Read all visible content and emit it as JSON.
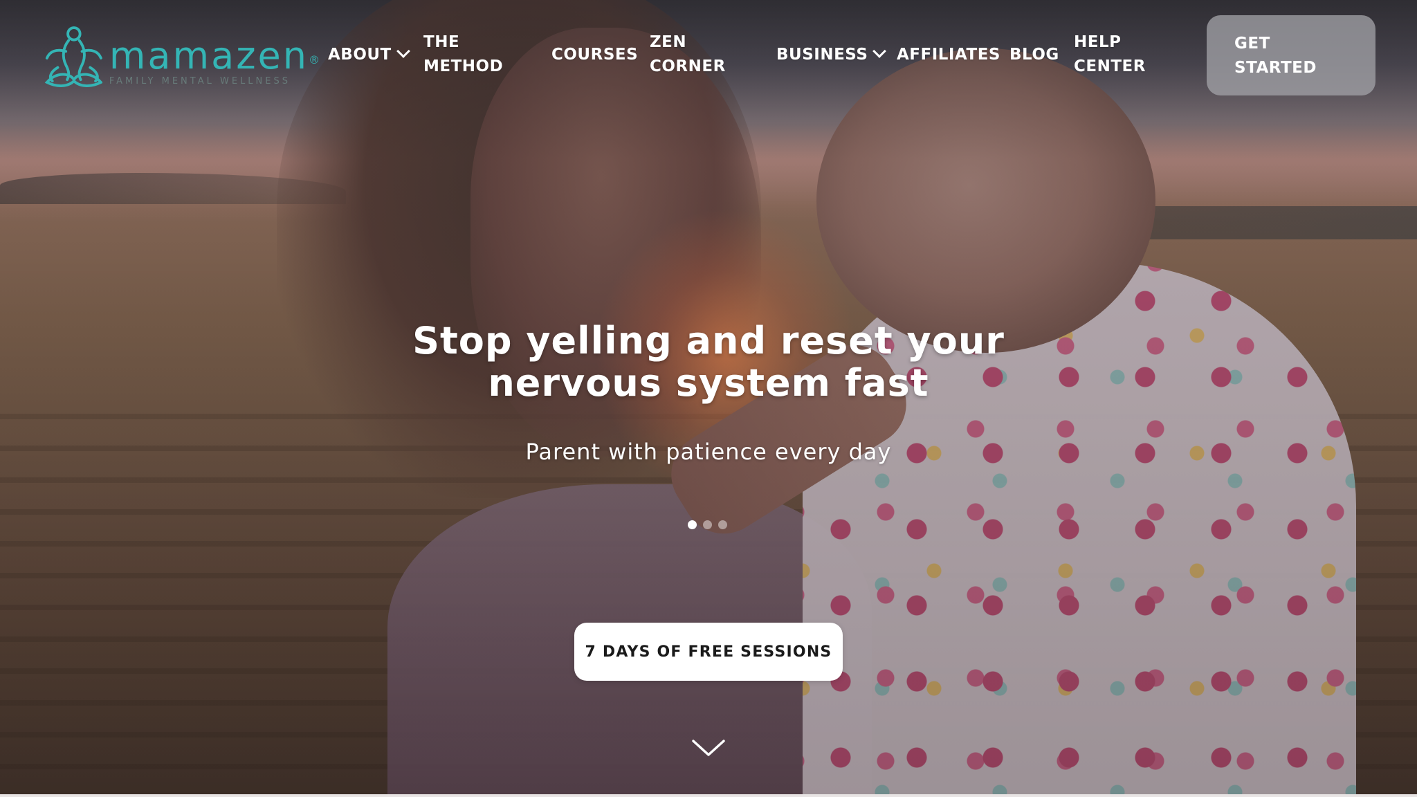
{
  "brand": {
    "name": "mamazen",
    "registered": "®",
    "tagline": "FAMILY MENTAL WELLNESS",
    "color": "#34b5b5"
  },
  "nav": {
    "items": [
      {
        "label": "ABOUT",
        "has_dropdown": true
      },
      {
        "label": "THE METHOD",
        "has_dropdown": false
      },
      {
        "label": "COURSES",
        "has_dropdown": false
      },
      {
        "label": "ZEN CORNER",
        "has_dropdown": false
      },
      {
        "label": "BUSINESS",
        "has_dropdown": true
      },
      {
        "label": "AFFILIATES",
        "has_dropdown": false
      },
      {
        "label": "BLOG",
        "has_dropdown": false
      },
      {
        "label": "HELP CENTER",
        "has_dropdown": false
      }
    ],
    "cta_label": "GET STARTED"
  },
  "hero": {
    "title": "Stop yelling and reset your nervous system fast",
    "subtitle": "Parent with patience every day",
    "carousel": {
      "slides": 3,
      "active_index": 0
    },
    "button_label": "7 DAYS OF FREE SESSIONS",
    "scroll_icon": "chevron-down-icon"
  }
}
